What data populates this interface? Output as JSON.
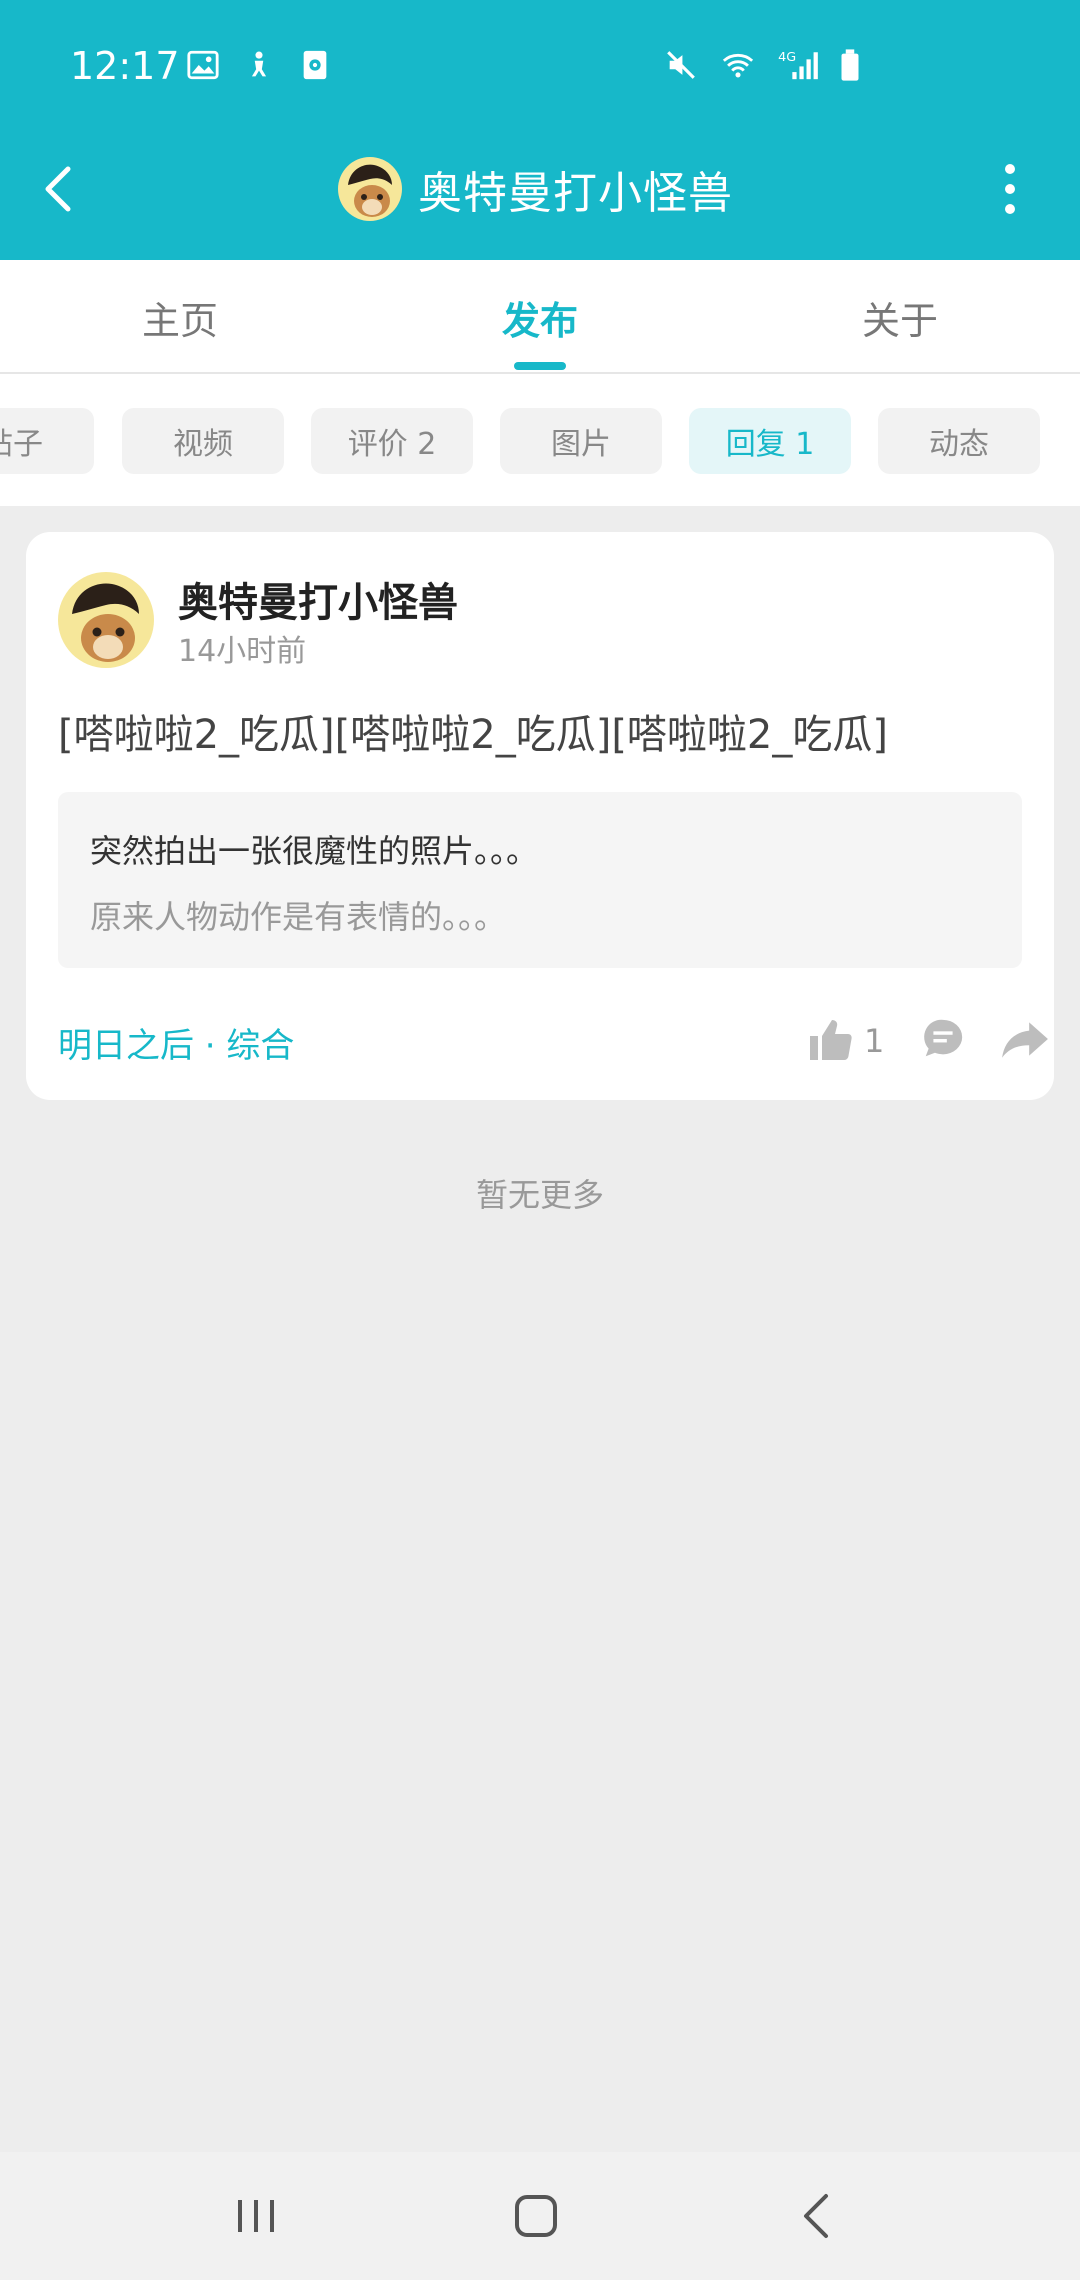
{
  "status_bar": {
    "time": "12:17",
    "left_icons": [
      "image-icon",
      "accessibility-icon",
      "screen-record-icon"
    ],
    "right_icons": [
      "mute-icon",
      "wifi-icon",
      "signal-4g-icon",
      "battery-icon"
    ],
    "network_label": "4G"
  },
  "header": {
    "title": "奥特曼打小怪兽",
    "back_icon": "chevron-left-icon",
    "more_icon": "more-vertical-icon"
  },
  "main_tabs": [
    {
      "label": "主页",
      "active": false
    },
    {
      "label": "发布",
      "active": true
    },
    {
      "label": "关于",
      "active": false
    }
  ],
  "sub_tabs": [
    {
      "label": "帖子",
      "active": false
    },
    {
      "label": "视频",
      "active": false
    },
    {
      "label": "评价 2",
      "active": false
    },
    {
      "label": "图片",
      "active": false
    },
    {
      "label": "回复 1",
      "active": true
    },
    {
      "label": "动态",
      "active": false
    }
  ],
  "post": {
    "username": "奥特曼打小怪兽",
    "time": "14小时前",
    "text": "[嗒啦啦2_吃瓜][嗒啦啦2_吃瓜][嗒啦啦2_吃瓜]",
    "quote_line1": "突然拍出一张很魔性的照片。。。",
    "quote_line2": "原来人物动作是有表情的。。。",
    "source": "明日之后 · 综合",
    "like_count": "1"
  },
  "footer_text": "暂无更多",
  "colors": {
    "accent": "#17b8c9",
    "background": "#ededed"
  }
}
